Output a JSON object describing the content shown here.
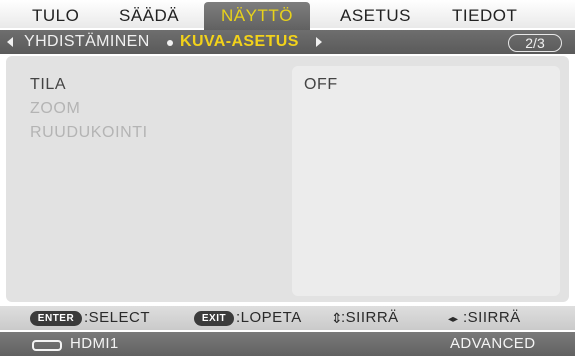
{
  "tabs": [
    {
      "label": "TULO"
    },
    {
      "label": "SÄÄDÄ"
    },
    {
      "label": "NÄYTTÖ",
      "active": true
    },
    {
      "label": "ASETUS"
    },
    {
      "label": "TIEDOT"
    }
  ],
  "submenu": {
    "items": [
      {
        "label": "YHDISTÄMINEN"
      },
      {
        "label": "KUVA-ASETUS",
        "active": true
      }
    ],
    "page_indicator": "2/3"
  },
  "menu_items": [
    {
      "label": "TILA",
      "enabled": true
    },
    {
      "label": "ZOOM",
      "enabled": false
    },
    {
      "label": "RUUDUKOINTI",
      "enabled": false
    }
  ],
  "value_panel": {
    "value": "OFF"
  },
  "guide": {
    "enter_key": "ENTER",
    "enter_label": ":SELECT",
    "exit_key": "EXIT",
    "exit_label": ":LOPETA",
    "updown_glyph": "⇕",
    "updown_label": ":SIIRRÄ",
    "leftright_glyph": "◂▸",
    "leftright_label": ":SIIRRÄ"
  },
  "status": {
    "input_icon": "hdmi-icon",
    "input": "HDMI1",
    "mode": "ADVANCED"
  },
  "colors": {
    "active_tab_text": "#e8d21a",
    "active_submenu_text": "#f2d21a",
    "bar_gray": "#616161",
    "panel_gray": "#e2e2e2"
  }
}
